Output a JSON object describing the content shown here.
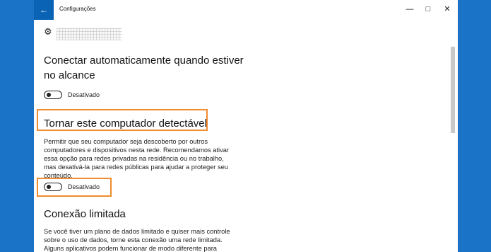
{
  "window": {
    "title": "Configurações",
    "back_icon": "arrow-left-icon",
    "controls": [
      "minimize-icon",
      "maximize-icon",
      "close-icon"
    ]
  },
  "network": {
    "icon": "gear-icon"
  },
  "sections": {
    "auto_connect": {
      "title": "Conectar automaticamente quando estiver no alcance",
      "toggle_label": "Desativado"
    },
    "discoverable": {
      "title": "Tornar este computador detectável",
      "description": "Permitir que seu computador seja descoberto por outros computadores e dispositivos nesta rede. Recomendamos ativar essa opção para redes privadas na residência ou no trabalho, mas desativá-la para redes públicas para ajudar a proteger seu conteúdo.",
      "toggle_label": "Desativado"
    },
    "metered": {
      "title": "Conexão limitada",
      "description": "Se você tiver um plano de dados limitado e quiser mais controle sobre o uso de dados, torne esta conexão uma rede limitada. Alguns aplicativos podem funcionar de modo diferente para"
    }
  },
  "colors": {
    "desktop": "#1a73c6",
    "accent": "#0a63b4",
    "highlight": "#f08c2e"
  }
}
